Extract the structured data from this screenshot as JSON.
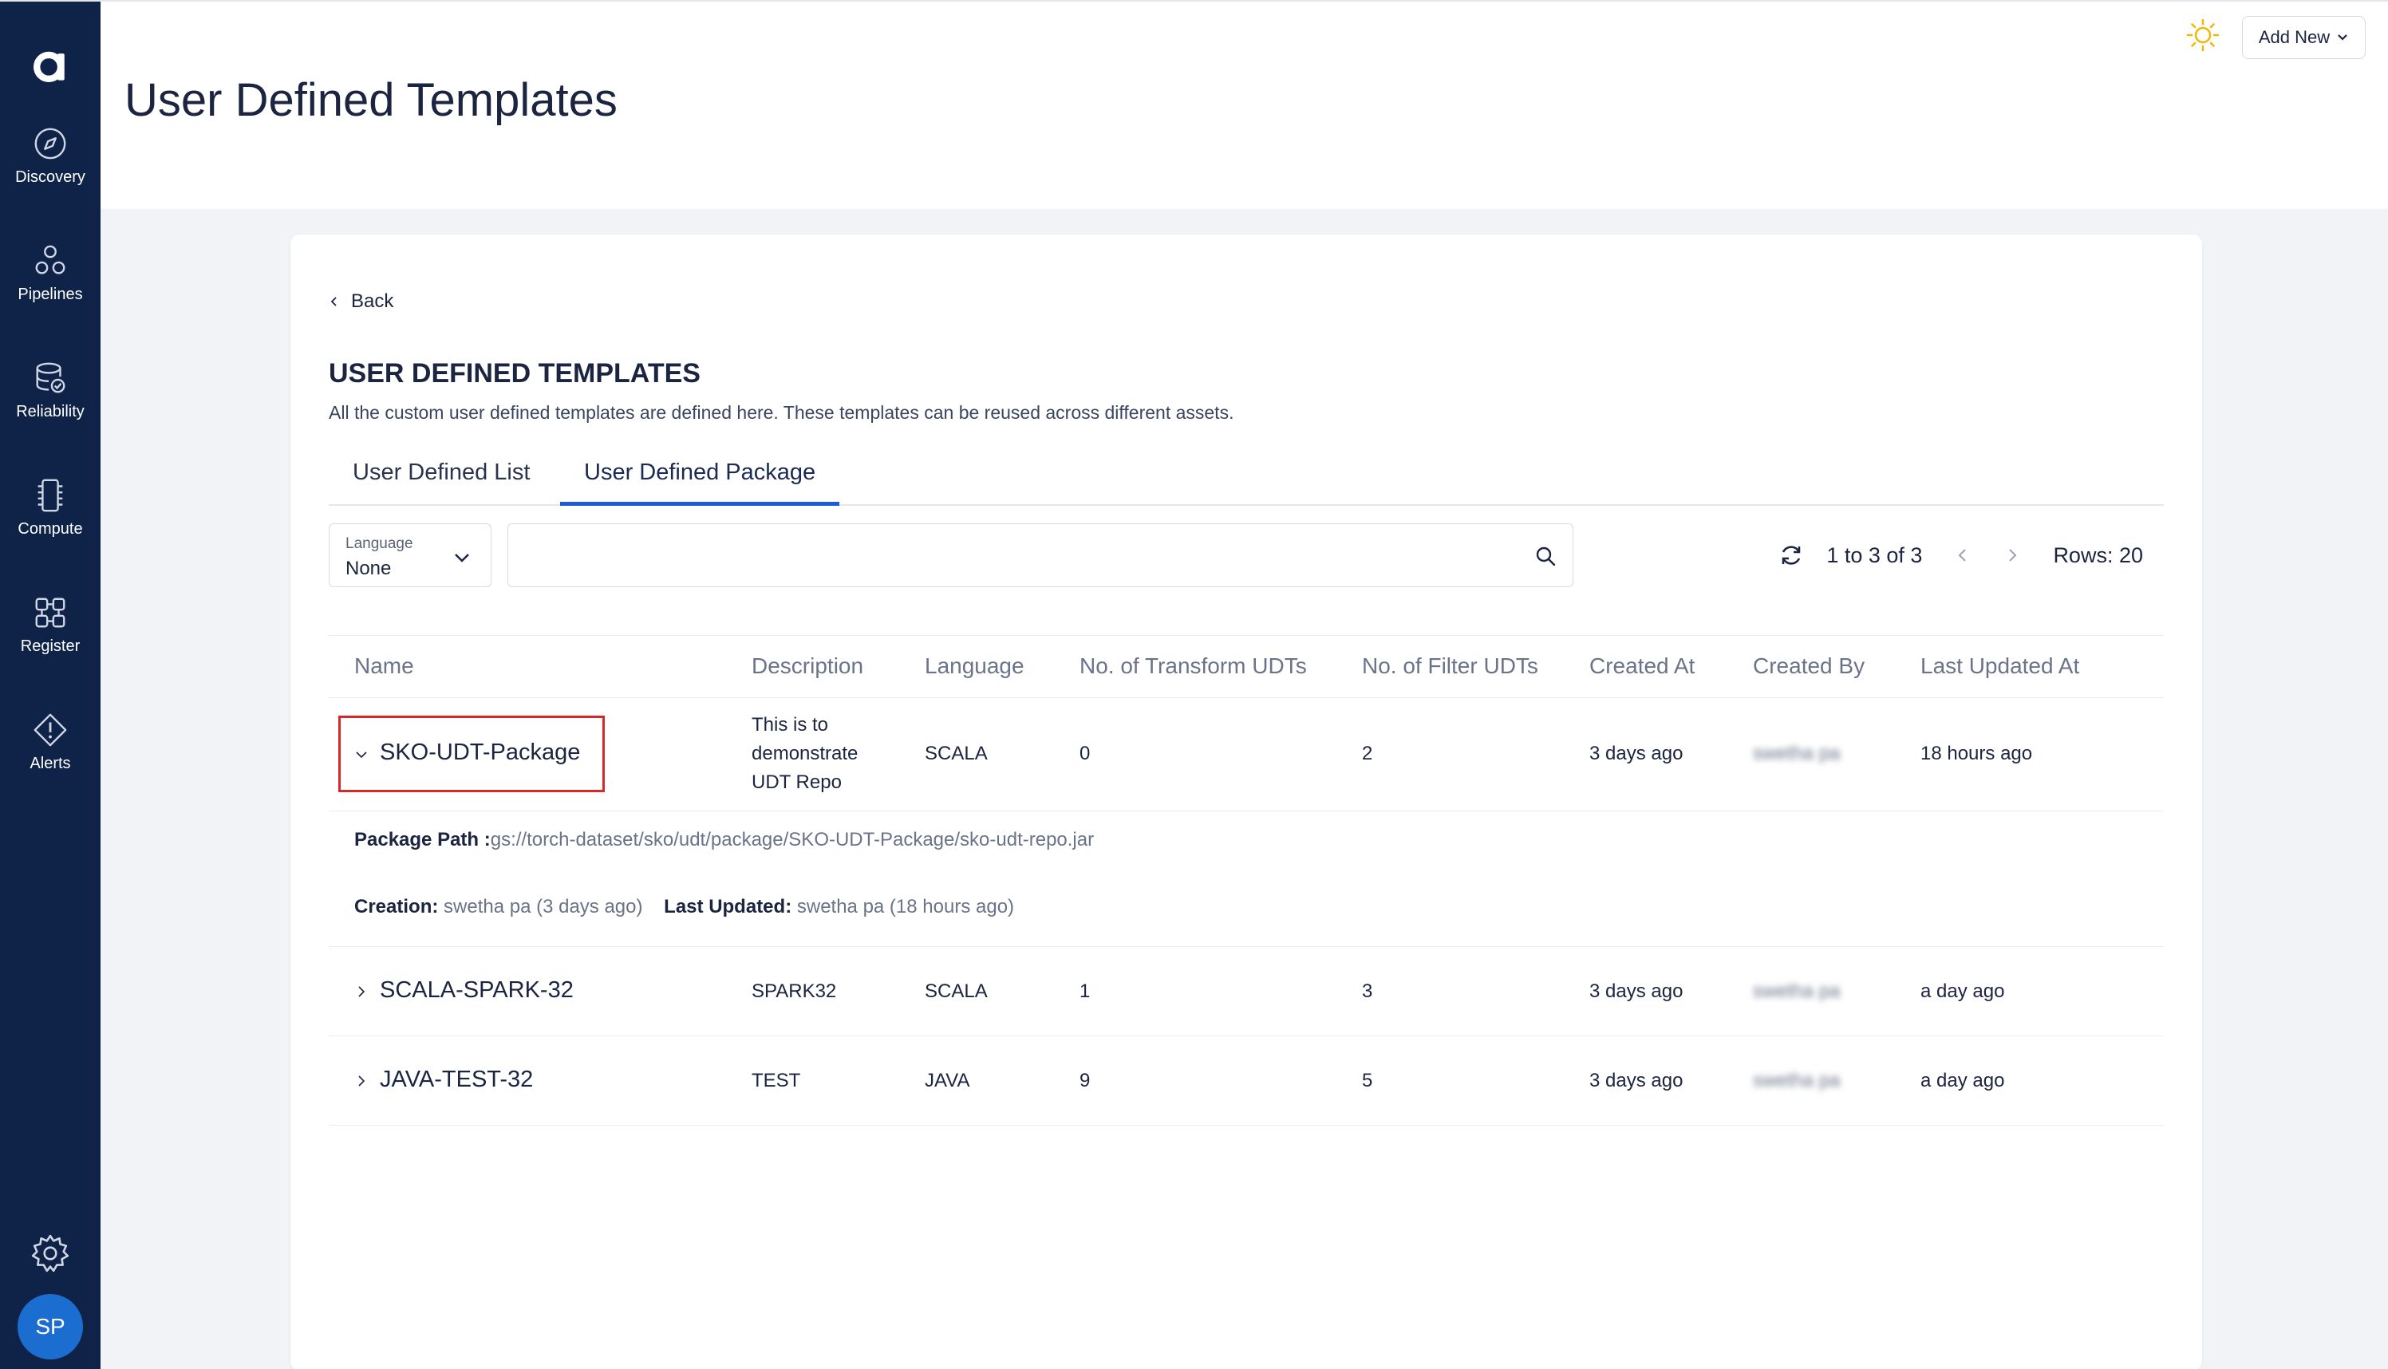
{
  "app": {
    "logo_letter": "a",
    "user_initials": "SP"
  },
  "sidebar": {
    "items": [
      {
        "label": "Discovery",
        "icon": "compass-icon"
      },
      {
        "label": "Pipelines",
        "icon": "pipeline-icon"
      },
      {
        "label": "Reliability",
        "icon": "database-check-icon"
      },
      {
        "label": "Compute",
        "icon": "chip-icon"
      },
      {
        "label": "Register",
        "icon": "register-icon"
      },
      {
        "label": "Alerts",
        "icon": "alert-diamond-icon"
      }
    ],
    "bottom": {
      "settings_icon": "gear-icon"
    }
  },
  "header": {
    "title": "User Defined Templates",
    "add_new_label": "Add New",
    "theme_icon": "sun-icon"
  },
  "content": {
    "back_label": "Back",
    "section_title": "USER DEFINED TEMPLATES",
    "section_desc": "All the custom user defined templates are defined here. These templates can be reused across different assets.",
    "tabs": [
      {
        "label": "User Defined List",
        "active": false
      },
      {
        "label": "User Defined Package",
        "active": true
      }
    ],
    "filter": {
      "language_label": "Language",
      "language_value": "None",
      "search_placeholder": ""
    },
    "pager": {
      "range_text": "1 to 3 of 3",
      "rows_text": "Rows: 20"
    }
  },
  "table": {
    "columns": [
      "Name",
      "Description",
      "Language",
      "No. of Transform UDTs",
      "No. of Filter UDTs",
      "Created At",
      "Created By",
      "Last Updated At"
    ],
    "rows": [
      {
        "name": "SKO-UDT-Package",
        "description": [
          "This is to",
          "demonstrate",
          "UDT Repo"
        ],
        "language": "SCALA",
        "transform_udts": "0",
        "filter_udts": "2",
        "created_at": "3 days ago",
        "created_by": "swetha pa",
        "last_updated": "18 hours ago",
        "expanded": true
      },
      {
        "name": "SCALA-SPARK-32",
        "description": [
          "SPARK32"
        ],
        "language": "SCALA",
        "transform_udts": "1",
        "filter_udts": "3",
        "created_at": "3 days ago",
        "created_by": "swetha pa",
        "last_updated": "a day ago",
        "expanded": false
      },
      {
        "name": "JAVA-TEST-32",
        "description": [
          "TEST"
        ],
        "language": "JAVA",
        "transform_udts": "9",
        "filter_udts": "5",
        "created_at": "3 days ago",
        "created_by": "swetha pa",
        "last_updated": "a day ago",
        "expanded": false
      }
    ],
    "detail": {
      "package_path_label": "Package Path :",
      "package_path_value": "gs://torch-dataset/sko/udt/package/SKO-UDT-Package/sko-udt-repo.jar",
      "creation_label": "Creation:",
      "creation_value": "swetha pa (3 days ago)",
      "updated_label": "Last Updated:",
      "updated_value": "swetha pa (18 hours ago)"
    }
  },
  "colors": {
    "sidebar_bg": "#0f2348",
    "accent": "#1c5bd8",
    "highlight_border": "#d42a2a",
    "avatar_bg": "#1c6dd0"
  }
}
